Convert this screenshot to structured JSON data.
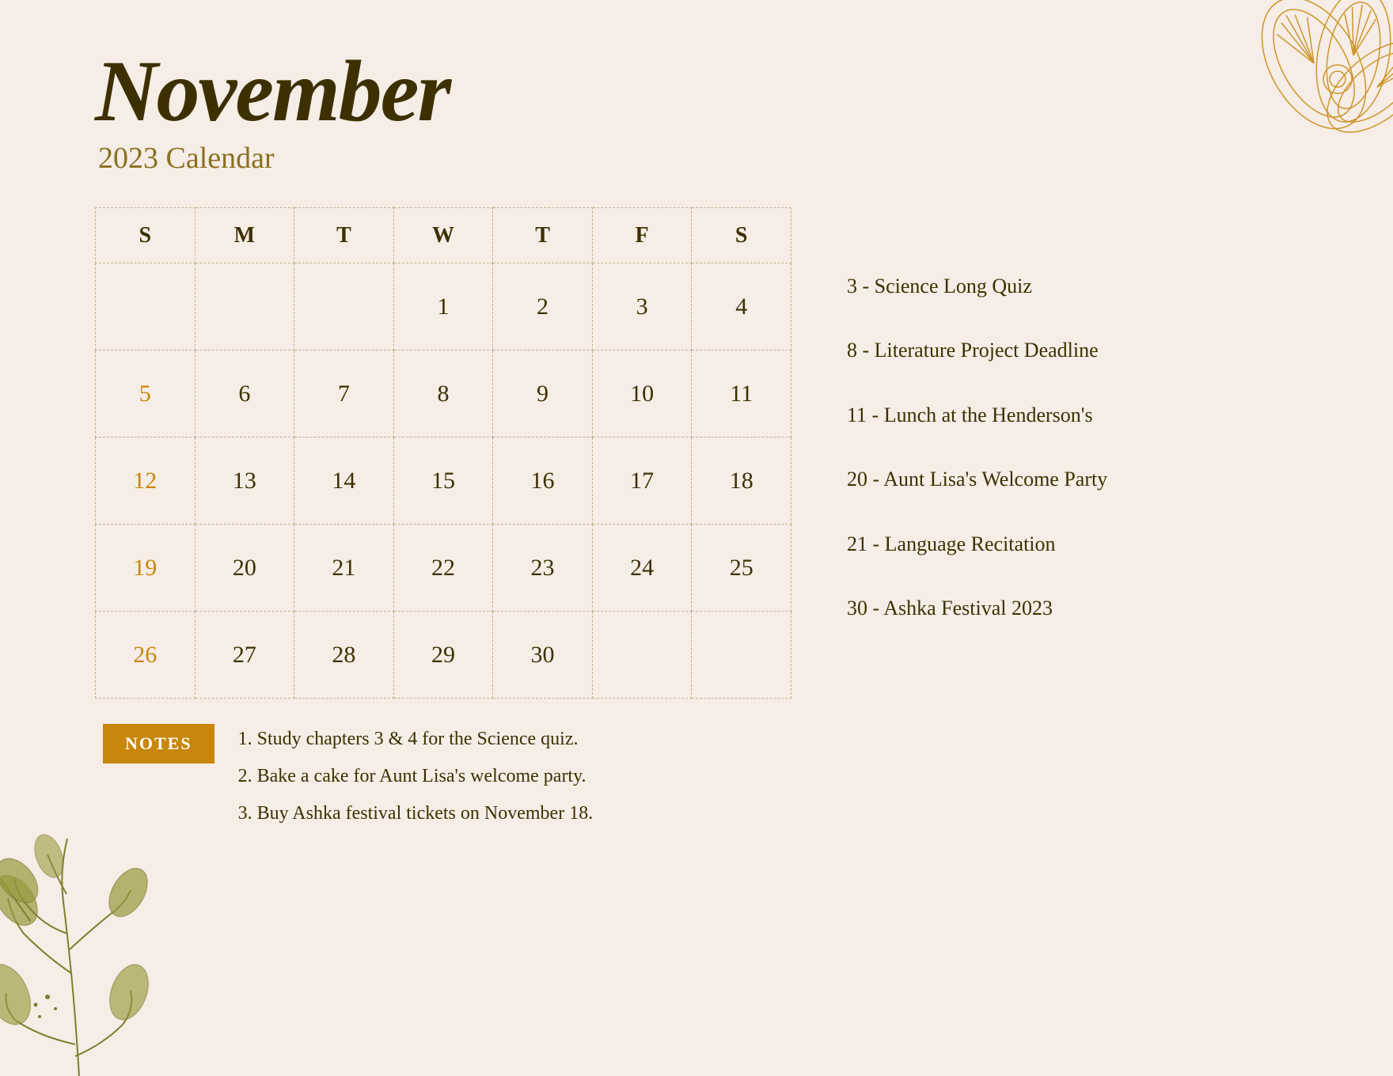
{
  "header": {
    "month": "November",
    "year_calendar": "2023 Calendar"
  },
  "calendar": {
    "days_of_week": [
      "S",
      "M",
      "T",
      "W",
      "T",
      "F",
      "S"
    ],
    "weeks": [
      [
        "",
        "",
        "",
        "1",
        "2",
        "3",
        "4"
      ],
      [
        "5",
        "6",
        "7",
        "8",
        "9",
        "10",
        "11"
      ],
      [
        "12",
        "13",
        "14",
        "15",
        "16",
        "17",
        "18"
      ],
      [
        "19",
        "20",
        "21",
        "22",
        "23",
        "24",
        "25"
      ],
      [
        "26",
        "27",
        "28",
        "29",
        "30",
        "",
        ""
      ]
    ],
    "sunday_dates": [
      "5",
      "12",
      "19",
      "26"
    ],
    "highlight_dates": []
  },
  "events": [
    "3 - Science Long Quiz",
    "8 - Literature Project Deadline",
    "11 - Lunch at the Henderson's",
    "20 - Aunt Lisa's Welcome Party",
    "21 - Language Recitation",
    "30 - Ashka Festival 2023"
  ],
  "notes": {
    "label": "NOTES",
    "items": [
      "1. Study chapters 3 & 4 for the Science quiz.",
      "2. Bake a cake for Aunt Lisa's welcome party.",
      "3. Buy Ashka festival tickets on November 18."
    ]
  }
}
